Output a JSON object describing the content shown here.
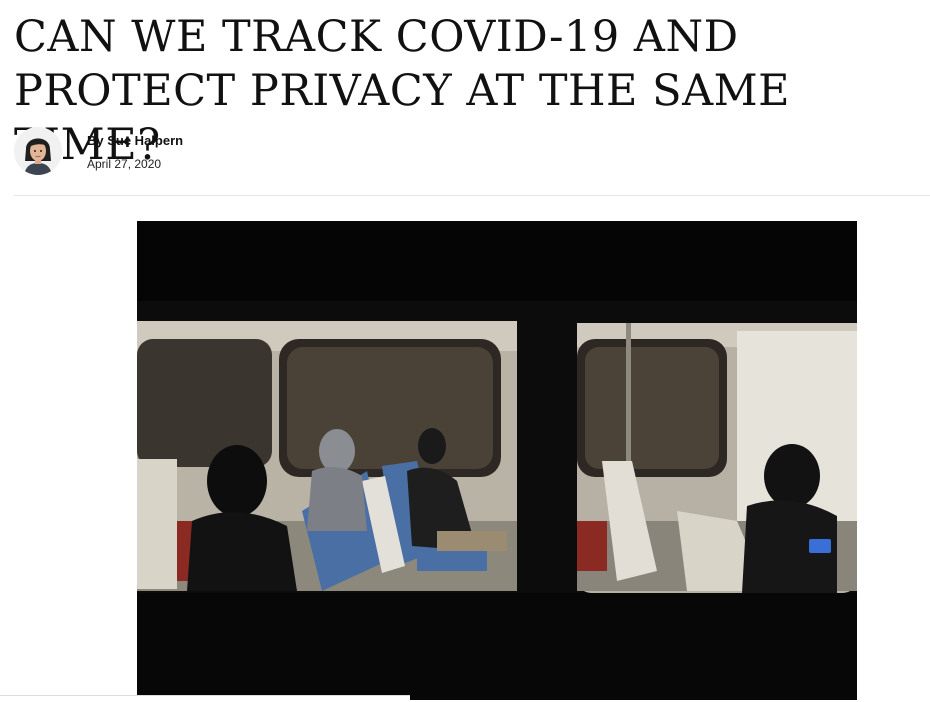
{
  "article": {
    "title": "CAN WE TRACK COVID-19 AND PROTECT PRIVACY AT THE SAME TIME?",
    "byline": "By Sue Halpern",
    "date": "April 27, 2020"
  },
  "icons": {
    "avatar": "author-avatar-illustration"
  },
  "colors": {
    "text": "#111111",
    "divider": "#e6e6e6",
    "photo_background": "#050505",
    "seat_blue": "#4a6fa5",
    "seat_red": "#8a2a22"
  }
}
